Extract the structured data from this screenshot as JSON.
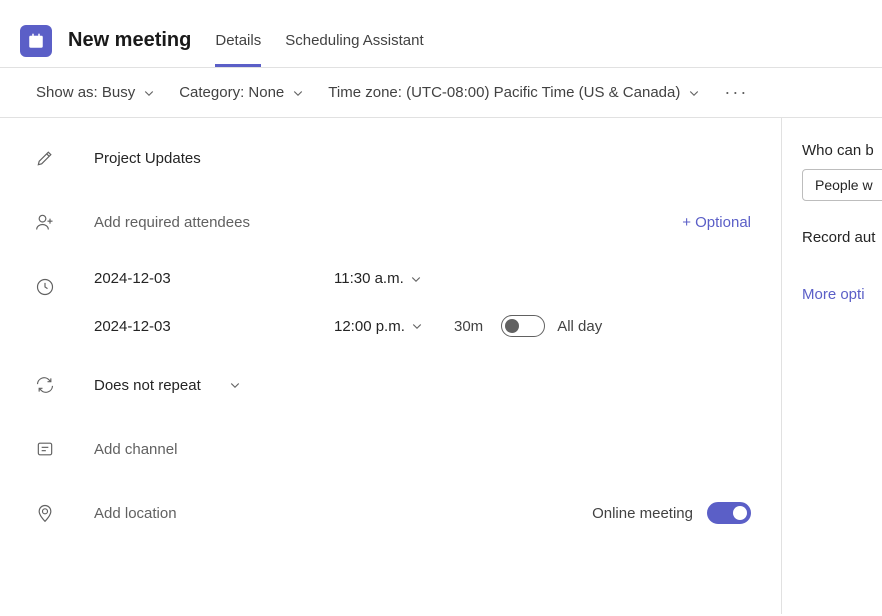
{
  "header": {
    "title": "New meeting",
    "tabs": [
      {
        "label": "Details",
        "active": true
      },
      {
        "label": "Scheduling Assistant",
        "active": false
      }
    ]
  },
  "options": {
    "show_as_label": "Show as: Busy",
    "category_label": "Category: None",
    "timezone_label": "Time zone: (UTC-08:00) Pacific Time (US & Canada)"
  },
  "form": {
    "title_value": "Project Updates",
    "attendees_placeholder": "Add required attendees",
    "optional_link": "+ Optional",
    "start_date": "2024-12-03",
    "start_time": "11:30 a.m.",
    "end_date": "2024-12-03",
    "end_time": "12:00 p.m.",
    "duration": "30m",
    "all_day_label": "All day",
    "repeat_value": "Does not repeat",
    "channel_placeholder": "Add channel",
    "location_placeholder": "Add location",
    "online_label": "Online meeting"
  },
  "side": {
    "bypass_label": "Who can b",
    "bypass_value": "People w",
    "record_label": "Record aut",
    "more_link": "More opti"
  }
}
